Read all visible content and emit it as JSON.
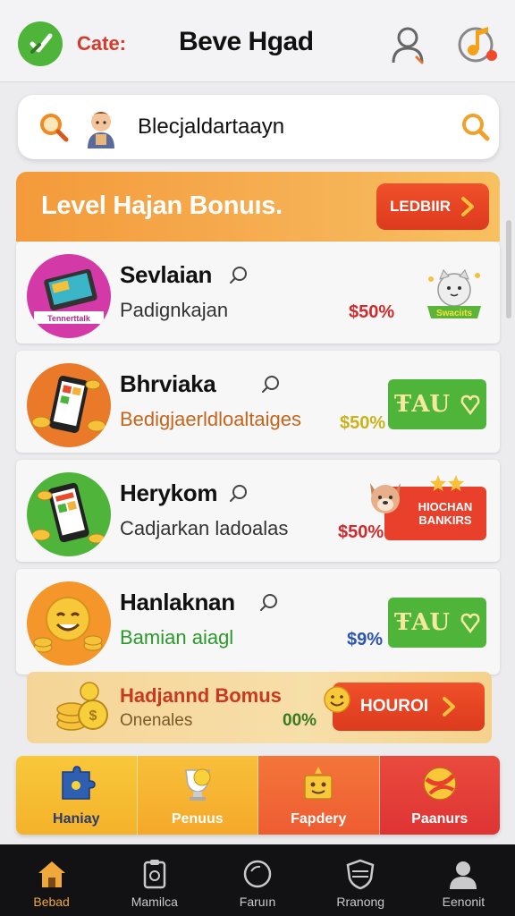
{
  "header": {
    "tag": "Cate:",
    "title": "Beve Hgad"
  },
  "search": {
    "value": "Blecjaldartaayn"
  },
  "banner": {
    "title": "Level Hajan Bonuıs.",
    "button_label": "LEDBIIR"
  },
  "items": [
    {
      "title": "Sevlaian",
      "subtitle": "Padignkajan",
      "price": "$50%",
      "price_color": "#d02a2a",
      "badge_text": "Swaciıts",
      "thumb_label": "Tennerttalk",
      "thumb_bg": "#d33aa8"
    },
    {
      "title": "Bhrviaka",
      "subtitle": "Bedigjaerldloaltaiges",
      "price": "$50%",
      "price_color": "#c9b21a",
      "action_label": "ŦAU"
    },
    {
      "title": "Heryko​m",
      "subtitle": "Cadjarkan ladoalas",
      "price": "$50%",
      "price_color": "#d02a2a",
      "badge_text": "HIOCHAN BANKIRS"
    },
    {
      "title": "Hanlaknan",
      "subtitle": "Bamian aiagl",
      "price": "$9%",
      "price_color": "#2a55b5",
      "action_label": "ŦAU"
    }
  ],
  "bonus": {
    "title": "Hadjannd Bomus",
    "subtitle": "Onenales",
    "percent": "00%",
    "button_label": "HOUROI"
  },
  "categories": [
    {
      "label": "Haniay",
      "bg": "#f7c13a"
    },
    {
      "label": "Penuus",
      "bg": "#f8b53a"
    },
    {
      "label": "Fapdery",
      "bg": "#f0703a"
    },
    {
      "label": "Paanurs",
      "bg": "#e83e3a"
    }
  ],
  "nav": [
    {
      "label": "Bebad",
      "icon": "home-icon",
      "active": true
    },
    {
      "label": "Mamilca",
      "icon": "clipboard-icon",
      "active": false
    },
    {
      "label": "Faruın",
      "icon": "circle-icon",
      "active": false
    },
    {
      "label": "Rranong",
      "icon": "shield-icon",
      "active": false
    },
    {
      "label": "Eenonit",
      "icon": "user-icon",
      "active": false
    }
  ]
}
